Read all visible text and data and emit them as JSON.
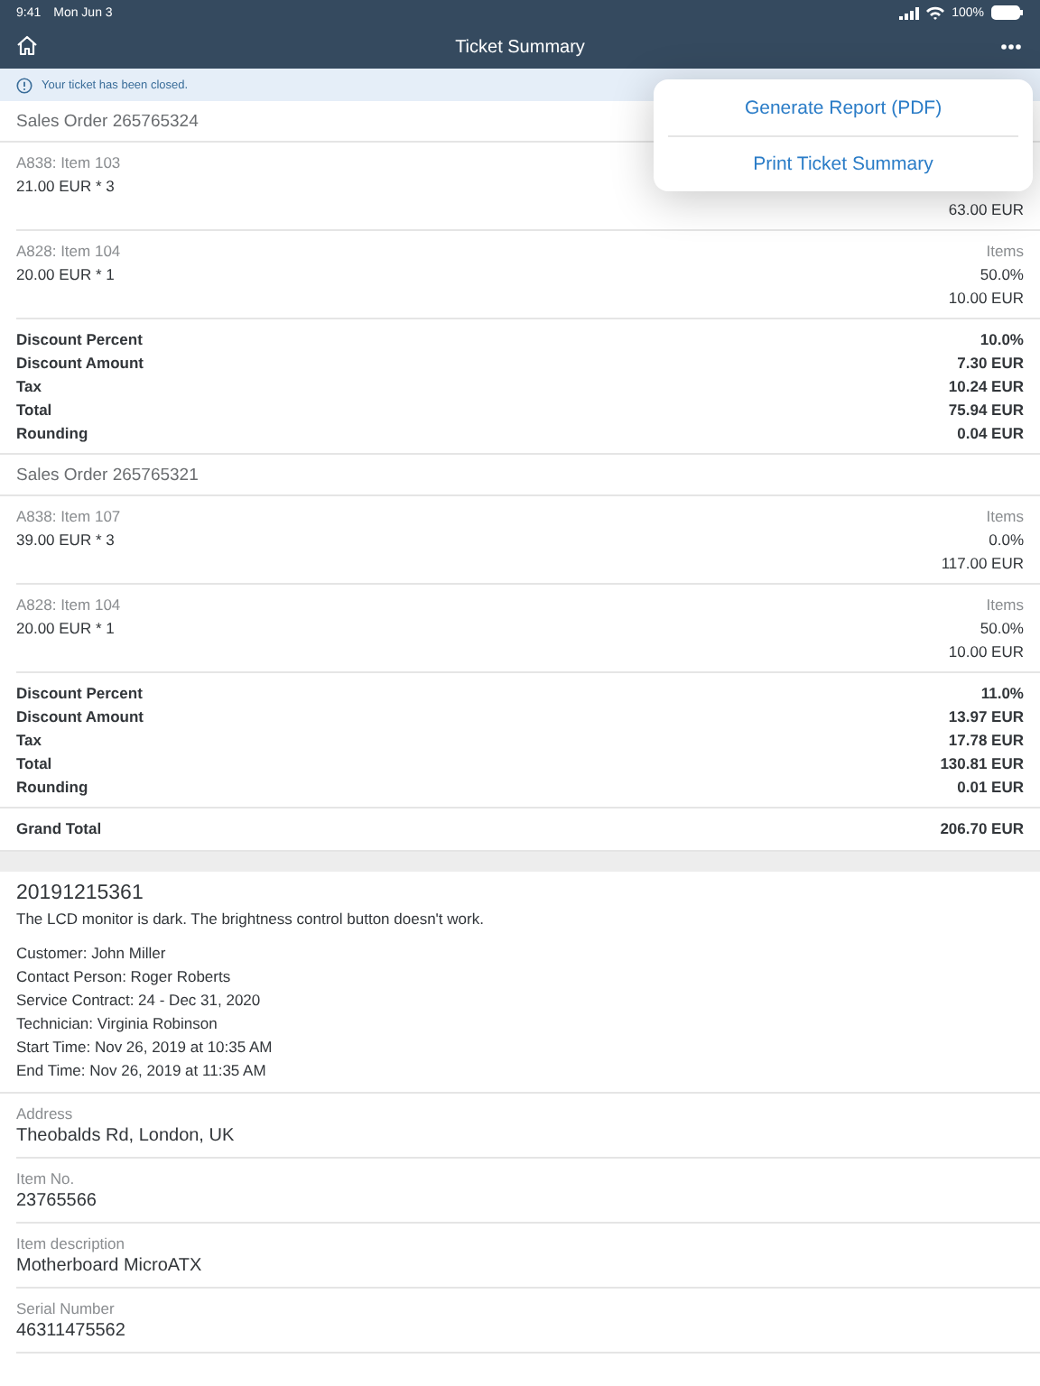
{
  "status_bar": {
    "time": "9:41",
    "date": "Mon Jun 3",
    "battery": "100%"
  },
  "nav": {
    "title": "Ticket Summary"
  },
  "banner": {
    "text": "Your ticket has been closed."
  },
  "menu": {
    "items": [
      "Generate Report (PDF)",
      "Print Ticket Summary"
    ]
  },
  "orders": [
    {
      "title": "Sales Order 265765324",
      "items": [
        {
          "name": "A838: Item 103",
          "price": "21.00 EUR * 3",
          "amount": "63.00 EUR"
        },
        {
          "name": "A828: Item 104",
          "price": "20.00 EUR * 1",
          "type": "Items",
          "discount": "50.0%",
          "amount": "10.00 EUR"
        }
      ],
      "totals": [
        {
          "label": "Discount Percent",
          "value": "10.0%"
        },
        {
          "label": "Discount Amount",
          "value": "7.30 EUR"
        },
        {
          "label": "Tax",
          "value": "10.24 EUR"
        },
        {
          "label": "Total",
          "value": "75.94 EUR"
        },
        {
          "label": "Rounding",
          "value": "0.04 EUR"
        }
      ]
    },
    {
      "title": "Sales Order 265765321",
      "items": [
        {
          "name": "A838: Item 107",
          "price": "39.00 EUR * 3",
          "type": "Items",
          "discount": "0.0%",
          "amount": "117.00 EUR"
        },
        {
          "name": "A828: Item 104",
          "price": "20.00 EUR * 1",
          "type": "Items",
          "discount": "50.0%",
          "amount": "10.00 EUR"
        }
      ],
      "totals": [
        {
          "label": "Discount Percent",
          "value": "11.0%"
        },
        {
          "label": "Discount Amount",
          "value": "13.97 EUR"
        },
        {
          "label": "Tax",
          "value": "17.78 EUR"
        },
        {
          "label": "Total",
          "value": "130.81 EUR"
        },
        {
          "label": "Rounding",
          "value": "0.01 EUR"
        }
      ]
    }
  ],
  "grand_total": {
    "label": "Grand Total",
    "value": "206.70 EUR"
  },
  "ticket": {
    "number": "20191215361",
    "description": "The LCD monitor is dark. The brightness control button doesn't work.",
    "details": [
      "Customer: John Miller",
      "Contact Person: Roger Roberts",
      "Service Contract: 24 - Dec 31, 2020",
      "Technician: Virginia Robinson",
      "Start Time: Nov 26, 2019 at 10:35 AM",
      "End Time: Nov 26, 2019 at 11:35 AM"
    ],
    "fields": [
      {
        "label": "Address",
        "value": "Theobalds Rd, London, UK"
      },
      {
        "label": "Item No.",
        "value": "23765566"
      },
      {
        "label": "Item description",
        "value": "Motherboard MicroATX"
      },
      {
        "label": "Serial Number",
        "value": "46311475562"
      }
    ]
  }
}
